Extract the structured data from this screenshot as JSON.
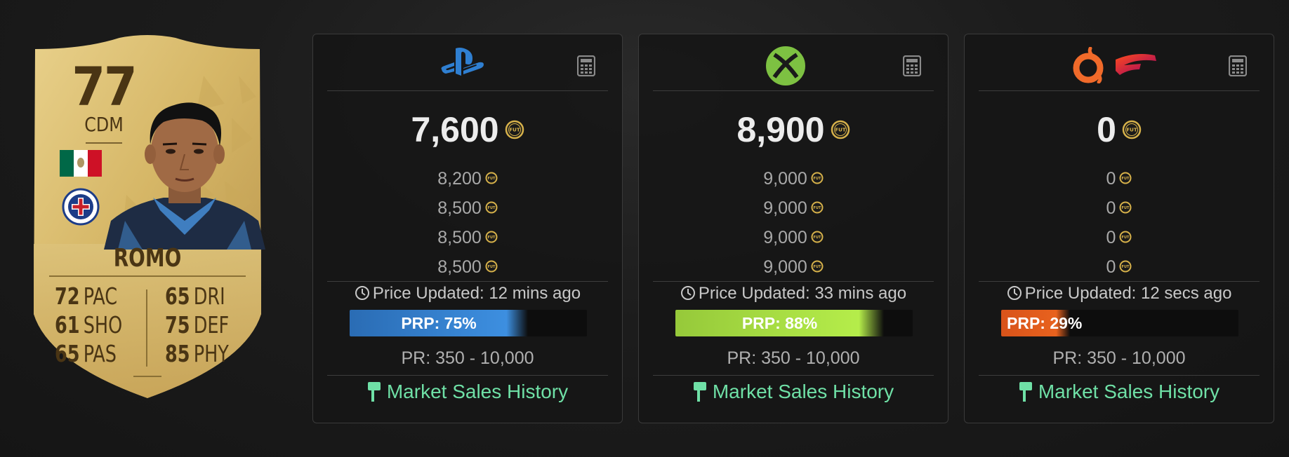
{
  "player": {
    "rating": "77",
    "position": "CDM",
    "name": "ROMO",
    "flag_colors": [
      "#006847",
      "#ffffff",
      "#ce1126"
    ],
    "club_icon": "cruz-azul-crest-icon",
    "stats_left": [
      {
        "value": "72",
        "label": "PAC"
      },
      {
        "value": "61",
        "label": "SHO"
      },
      {
        "value": "65",
        "label": "PAS"
      }
    ],
    "stats_right": [
      {
        "value": "65",
        "label": "DRI"
      },
      {
        "value": "75",
        "label": "DEF"
      },
      {
        "value": "85",
        "label": "PHY"
      }
    ]
  },
  "platforms": [
    {
      "id": "playstation",
      "icons": [
        "playstation-logo-icon"
      ],
      "price": "7,600",
      "recent_prices": [
        "8,200",
        "8,500",
        "8,500",
        "8,500"
      ],
      "updated": "Price Updated: 12 mins ago",
      "prp_label": "PRP: 75%",
      "prp_fraction": 0.75,
      "prp_color": "#3d8fe0",
      "pr_range": "PR: 350 - 10,000",
      "market_link": "Market Sales History"
    },
    {
      "id": "xbox",
      "icons": [
        "xbox-logo-icon"
      ],
      "price": "8,900",
      "recent_prices": [
        "9,000",
        "9,000",
        "9,000",
        "9,000"
      ],
      "updated": "Price Updated: 33 mins ago",
      "prp_label": "PRP: 88%",
      "prp_fraction": 0.88,
      "prp_color": "#b5ed4a",
      "pr_range": "PR: 350 - 10,000",
      "market_link": "Market Sales History"
    },
    {
      "id": "pc",
      "icons": [
        "origin-logo-icon",
        "stadia-logo-icon"
      ],
      "price": "0",
      "recent_prices": [
        "0",
        "0",
        "0",
        "0"
      ],
      "updated": "Price Updated: 12 secs ago",
      "prp_label": "PRP: 29%",
      "prp_fraction": 0.29,
      "prp_color": "#e8621e",
      "pr_range": "PR: 350 - 10,000",
      "market_link": "Market Sales History"
    }
  ],
  "colors": {
    "card_gold": "#d9bd6e",
    "link_green": "#6fe0a6",
    "coin_gold": "#d6b14a"
  }
}
